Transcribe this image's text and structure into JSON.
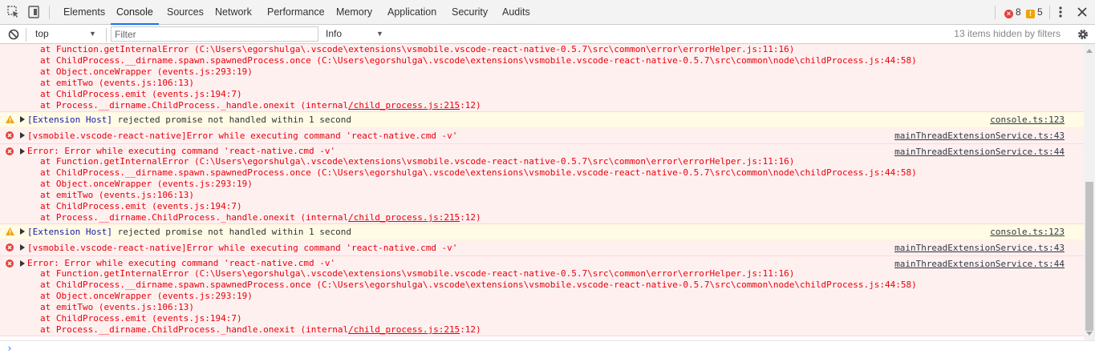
{
  "tabs": [
    {
      "label": "Elements"
    },
    {
      "label": "Console"
    },
    {
      "label": "Sources"
    },
    {
      "label": "Network"
    },
    {
      "label": "Performance"
    },
    {
      "label": "Memory"
    },
    {
      "label": "Application"
    },
    {
      "label": "Security"
    },
    {
      "label": "Audits"
    }
  ],
  "active_tab": "Console",
  "counters": {
    "errors": "8",
    "warnings": "5"
  },
  "filterbar": {
    "context": "top",
    "filter_placeholder": "Filter",
    "level": "Info",
    "hidden_info": "13 items hidden by filters"
  },
  "colors": {
    "error_bg": "#fff0f0",
    "error_text": "#e8000a",
    "warn_bg": "#fffbe5",
    "accent": "#1a73e8"
  },
  "messages": {
    "m0": {
      "lines": [
        "at Function.getInternalError (C:\\Users\\egorshulga\\.vscode\\extensions\\vsmobile.vscode-react-native-0.5.7\\src\\common\\error\\errorHelper.js:11:16)",
        "at ChildProcess.__dirname.spawn.spawnedProcess.once (C:\\Users\\egorshulga\\.vscode\\extensions\\vsmobile.vscode-react-native-0.5.7\\src\\common\\node\\childProcess.js:44:58)",
        "at Object.onceWrapper (events.js:293:19)",
        "at emitTwo (events.js:106:13)",
        "at ChildProcess.emit (events.js:194:7)"
      ],
      "last_prefix": "at Process.__dirname.ChildProcess._handle.onexit (internal",
      "last_link": "/child_process.js:215",
      "last_suffix": ":12)"
    },
    "m1": {
      "tag": "[Extension Host]",
      "text": " rejected promise not handled within 1 second",
      "source": "console.ts:123"
    },
    "m2": {
      "text": "[vsmobile.vscode-react-native]Error while executing command 'react-native.cmd -v'",
      "source": "mainThreadExtensionService.ts:43"
    },
    "m3": {
      "text": "Error: Error while executing command 'react-native.cmd -v'",
      "source": "mainThreadExtensionService.ts:44",
      "lines": [
        "at Function.getInternalError (C:\\Users\\egorshulga\\.vscode\\extensions\\vsmobile.vscode-react-native-0.5.7\\src\\common\\error\\errorHelper.js:11:16)",
        "at ChildProcess.__dirname.spawn.spawnedProcess.once (C:\\Users\\egorshulga\\.vscode\\extensions\\vsmobile.vscode-react-native-0.5.7\\src\\common\\node\\childProcess.js:44:58)",
        "at Object.onceWrapper (events.js:293:19)",
        "at emitTwo (events.js:106:13)",
        "at ChildProcess.emit (events.js:194:7)"
      ],
      "last_prefix": "at Process.__dirname.ChildProcess._handle.onexit (internal",
      "last_link": "/child_process.js:215",
      "last_suffix": ":12)"
    },
    "m4": {
      "tag": "[Extension Host]",
      "text": " rejected promise not handled within 1 second",
      "source": "console.ts:123"
    },
    "m5": {
      "text": "[vsmobile.vscode-react-native]Error while executing command 'react-native.cmd -v'",
      "source": "mainThreadExtensionService.ts:43"
    },
    "m6": {
      "text": "Error: Error while executing command 'react-native.cmd -v'",
      "source": "mainThreadExtensionService.ts:44",
      "lines": [
        "at Function.getInternalError (C:\\Users\\egorshulga\\.vscode\\extensions\\vsmobile.vscode-react-native-0.5.7\\src\\common\\error\\errorHelper.js:11:16)",
        "at ChildProcess.__dirname.spawn.spawnedProcess.once (C:\\Users\\egorshulga\\.vscode\\extensions\\vsmobile.vscode-react-native-0.5.7\\src\\common\\node\\childProcess.js:44:58)",
        "at Object.onceWrapper (events.js:293:19)",
        "at emitTwo (events.js:106:13)",
        "at ChildProcess.emit (events.js:194:7)"
      ],
      "last_prefix": "at Process.__dirname.ChildProcess._handle.onexit (internal",
      "last_link": "/child_process.js:215",
      "last_suffix": ":12)"
    }
  },
  "prompt_symbol": "›"
}
